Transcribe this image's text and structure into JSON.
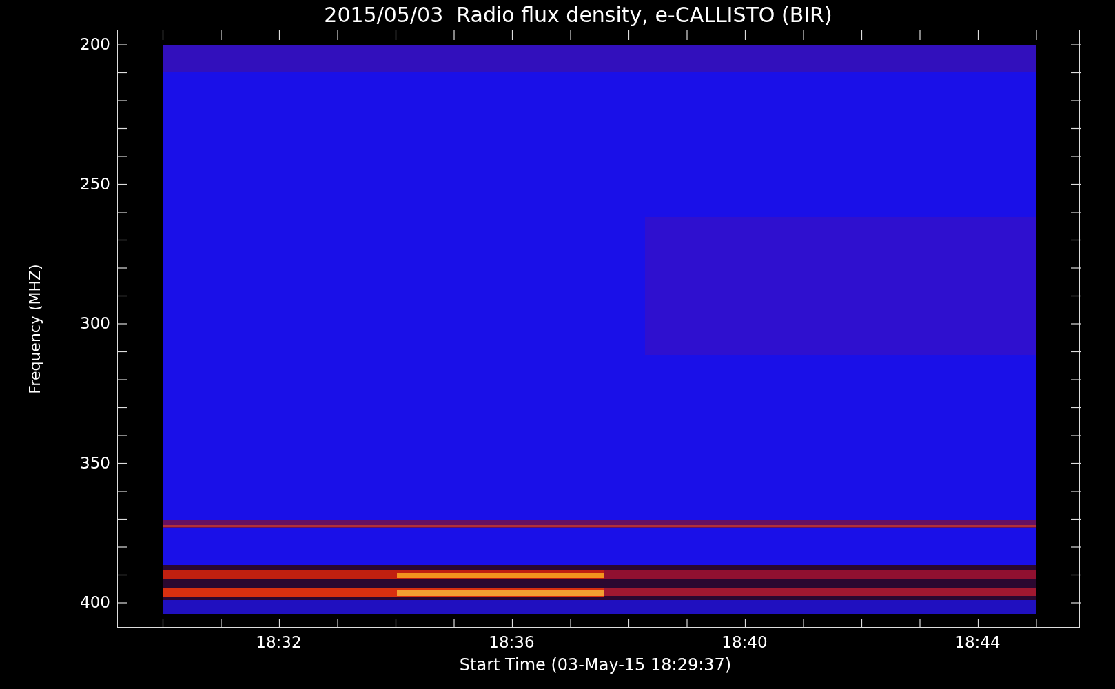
{
  "title": "2015/05/03  Radio flux density, e-CALLISTO (BIR)",
  "y_axis": {
    "label": "Frequency (MHZ)",
    "ticks": [
      "200",
      "250",
      "300",
      "350",
      "400"
    ]
  },
  "x_axis": {
    "label": "Start Time (03-May-15 18:29:37)",
    "ticks": [
      "18:32",
      "18:36",
      "18:40",
      "18:44"
    ]
  }
}
